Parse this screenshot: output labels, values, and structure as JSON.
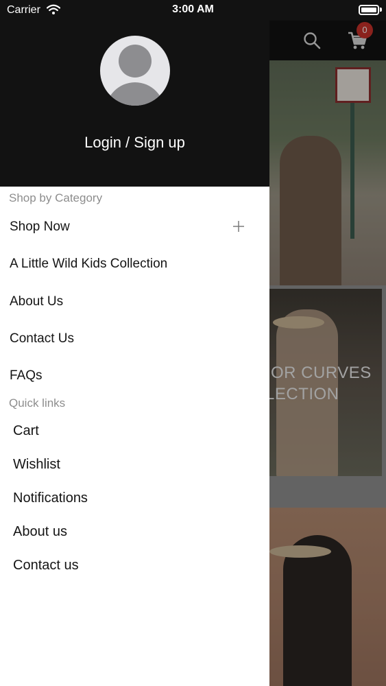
{
  "status_bar": {
    "carrier": "Carrier",
    "time": "3:00 AM"
  },
  "header": {
    "cart_count": "0",
    "more_glyph": "."
  },
  "promo": {
    "line1": "OR CURVES",
    "line2": "LECTION"
  },
  "drawer": {
    "login_label": "Login / Sign up",
    "shop_section_title": "Shop by Category",
    "categories": [
      {
        "label": "Shop Now",
        "expandable": true
      },
      {
        "label": "A Little Wild Kids Collection"
      },
      {
        "label": "About Us"
      },
      {
        "label": "Contact Us"
      },
      {
        "label": "FAQs"
      }
    ],
    "quick_section_title": "Quick links",
    "quick_links": [
      {
        "label": "Cart"
      },
      {
        "label": "Wishlist"
      },
      {
        "label": "Notifications"
      },
      {
        "label": "About us"
      },
      {
        "label": "Contact us"
      }
    ]
  },
  "colors": {
    "header_bg": "#121212",
    "badge": "#c6322a",
    "section_title": "#8d8d8d"
  },
  "icons": [
    "wifi-icon",
    "battery-icon",
    "search-icon",
    "cart-icon",
    "avatar-icon",
    "plus-icon"
  ]
}
